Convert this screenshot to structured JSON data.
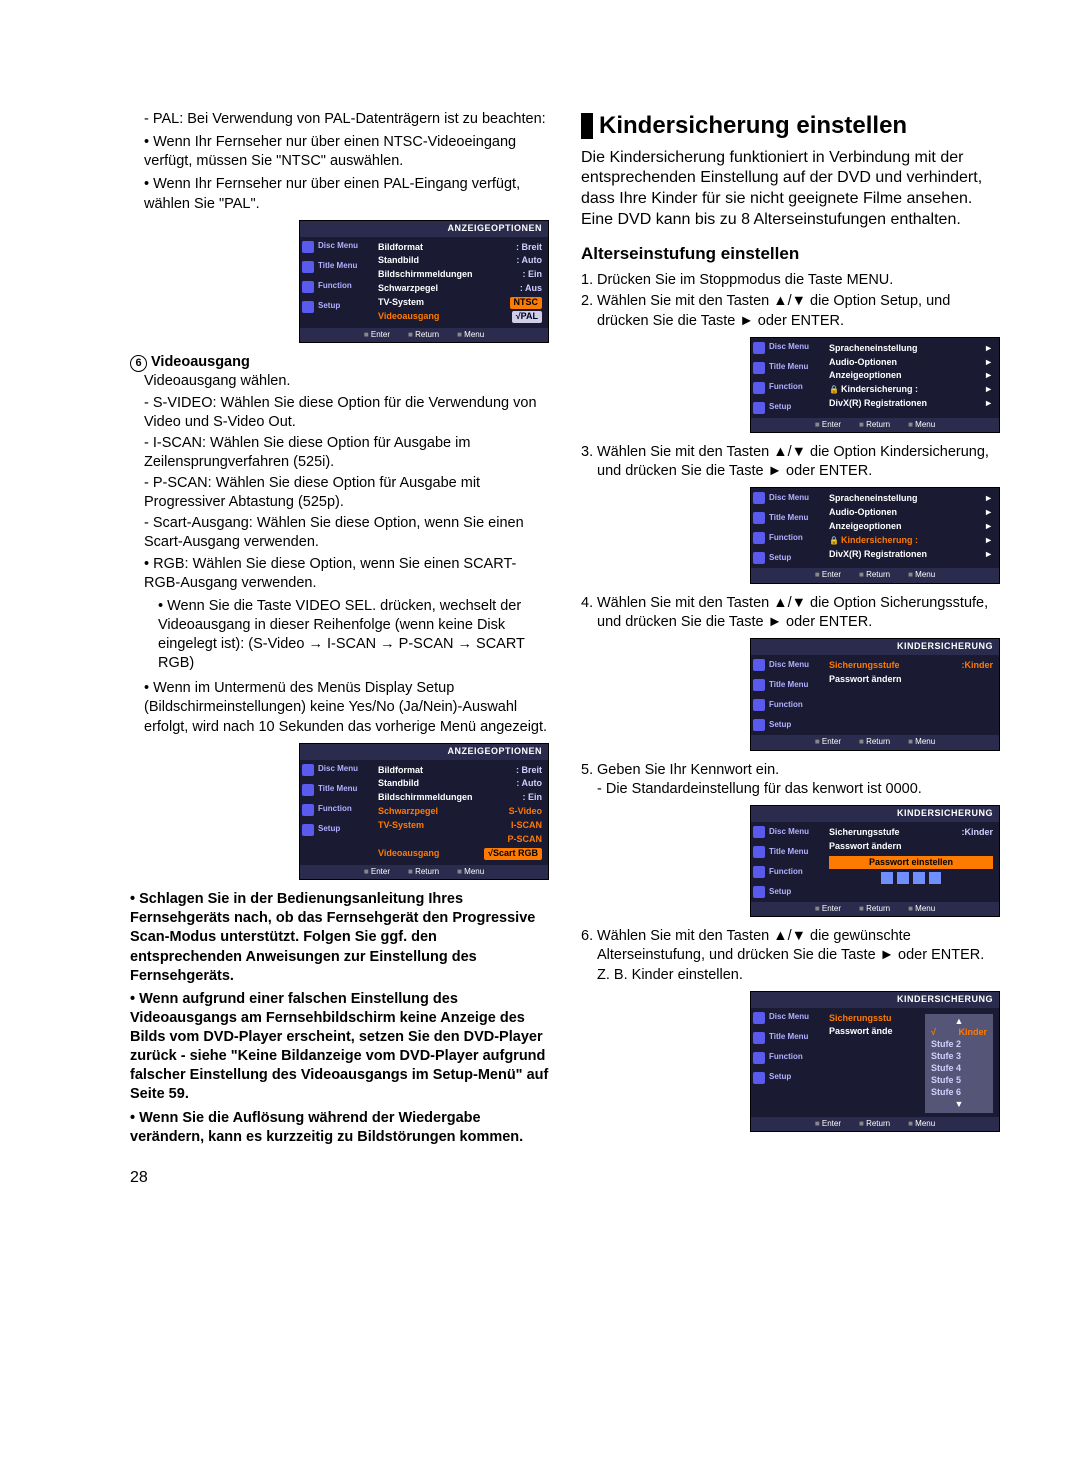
{
  "page_number": "28",
  "left": {
    "pal_note": "- PAL: Bei Verwendung von PAL-Datenträgern ist zu beachten:",
    "ntsc_bullet": "• Wenn Ihr Fernseher nur über einen NTSC-Videoeingang verfügt, müssen Sie \"NTSC\" auswählen.",
    "pal_bullet": "• Wenn Ihr Fernseher nur über einen PAL-Eingang verfügt, wählen Sie \"PAL\".",
    "osd1": {
      "title": "ANZEIGEOPTIONEN",
      "sidebar": [
        "Disc Menu",
        "Title Menu",
        "Function",
        "Setup"
      ],
      "rows": [
        {
          "l": "Bildformat",
          "v": ": Breit"
        },
        {
          "l": "Standbild",
          "v": ": Auto"
        },
        {
          "l": "Bildschirmmeldungen",
          "v": ": Ein"
        },
        {
          "l": "Schwarzpegel",
          "v": ": Aus"
        },
        {
          "l": "TV-System",
          "v": "NTSC",
          "style": "badge"
        },
        {
          "l": "Videoausgang",
          "v": "√PAL",
          "style": "drop"
        }
      ],
      "footer": [
        "Enter",
        "Return",
        "Menu"
      ]
    },
    "videoausgang_h": "Videoausgang",
    "videoausgang_p": "Videoausgang wählen.",
    "svideo": "- S-VIDEO: Wählen Sie diese Option für die Verwendung von Video und S-Video Out.",
    "iscan": "- I-SCAN: Wählen Sie diese Option für Ausgabe im Zeilensprungverfahren (525i).",
    "pscan": "- P-SCAN: Wählen Sie diese Option für Ausgabe mit Progressiver Abtastung (525p).",
    "scart": "- Scart-Ausgang: Wählen Sie diese Option, wenn Sie einen Scart-Ausgang verwenden.",
    "rgb": "• RGB: Wählen Sie diese Option, wenn Sie einen SCART-RGB-Ausgang verwenden.",
    "videosel": "• Wenn Sie die Taste VIDEO SEL. drücken, wechselt der Videoausgang in dieser Reihenfolge (wenn keine Disk eingelegt ist): (S-Video → I-SCAN → P-SCAN → SCART RGB)",
    "submenu_note": "• Wenn im Untermenü des Menüs Display Setup (Bildschirmeinstellungen) keine Yes/No (Ja/Nein)-Auswahl erfolgt, wird nach 10 Sekunden das vorherige Menü angezeigt.",
    "osd2": {
      "title": "ANZEIGEOPTIONEN",
      "rows": [
        {
          "l": "Bildformat",
          "v": ": Breit"
        },
        {
          "l": "Standbild",
          "v": ": Auto"
        },
        {
          "l": "Bildschirmmeldungen",
          "v": ": Ein"
        },
        {
          "l": "Schwarzpegel",
          "v": "S-Video",
          "style": "hl"
        },
        {
          "l": "TV-System",
          "v": "I-SCAN",
          "style": "hl"
        },
        {
          "l": "",
          "v": "P-SCAN",
          "style": "hl"
        },
        {
          "l": "Videoausgang",
          "v": "√Scart RGB",
          "style": "hlbadge"
        }
      ]
    },
    "warn1": "• Schlagen Sie in der Bedienungsanleitung Ihres Fernsehgeräts nach, ob das Fernsehgerät den Progressive Scan-Modus unterstützt. Folgen Sie ggf. den entsprechenden Anweisungen zur Einstellung des Fernsehgeräts.",
    "warn2": "• Wenn aufgrund einer falschen Einstellung des Videoausgangs am Fernsehbildschirm keine Anzeige des Bilds vom DVD-Player erscheint, setzen Sie den DVD-Player zurück - siehe \"Keine Bildanzeige vom DVD-Player aufgrund falscher Einstellung des Videoausgangs im Setup-Menü\" auf Seite 59.",
    "warn3": "• Wenn Sie die Auflösung während der Wiedergabe verändern, kann es kurzzeitig zu Bildstörungen kommen."
  },
  "right": {
    "title": "Kindersicherung einstellen",
    "intro": "Die Kindersicherung funktioniert in Verbindung mit der entsprechenden Einstellung auf der DVD und verhindert, dass Ihre Kinder für sie nicht geeignete Filme ansehen. Eine DVD kann bis zu 8 Alterseinstufungen enthalten.",
    "sub": "Alterseinstufung einstellen",
    "s1": "Drücken Sie im Stoppmodus die Taste MENU.",
    "s2a": "Wählen Sie mit den Tasten ",
    "s2b": " die Option Setup, und drücken Sie die Taste ► oder ENTER.",
    "osd_setup": {
      "title": "",
      "rows": [
        {
          "l": "Spracheneinstellung",
          "v": "►"
        },
        {
          "l": "Audio-Optionen",
          "v": "►"
        },
        {
          "l": "Anzeigeoptionen",
          "v": "►"
        },
        {
          "l": "Kindersicherung :",
          "v": "►",
          "lock": true
        },
        {
          "l": "DivX(R) Registrationen",
          "v": "►"
        }
      ]
    },
    "s3a": "Wählen Sie mit den Tasten ",
    "s3b": " die Option Kindersicherung, und drücken Sie die Taste ► oder ENTER.",
    "s4a": "Wählen Sie mit den Tasten ",
    "s4b": " die Option Sicherungsstufe, und drücken Sie die Taste ► oder ENTER.",
    "osd_kind1": {
      "title": "KINDERSICHERUNG",
      "rows": [
        {
          "l": "Sicherungsstufe",
          "v": ":Kinder",
          "hl": true
        },
        {
          "l": "Passwort ändern",
          "v": ""
        }
      ]
    },
    "s5": "Geben Sie Ihr Kennwort ein.",
    "s5b": "- Die Standardeinstellung für das kenwort ist 0000.",
    "osd_kind2": {
      "title": "KINDERSICHERUNG",
      "rows": [
        {
          "l": "Sicherungsstufe",
          "v": ":Kinder"
        },
        {
          "l": "Passwort ändern",
          "v": ""
        }
      ],
      "pwlabel": "Passwort einstellen"
    },
    "s6a": "Wählen Sie mit den Tasten ",
    "s6b": " die gewünschte Alterseinstufung, und drücken Sie die Taste ► oder ENTER. Z. B. Kinder einstellen.",
    "osd_kind3": {
      "title": "KINDERSICHERUNG",
      "rows": [
        {
          "l": "Sicherungsstu",
          "v": ""
        },
        {
          "l": "Passwort ände",
          "v": ""
        }
      ],
      "levels": [
        "Kinder",
        "Stufe 2",
        "Stufe 3",
        "Stufe 4",
        "Stufe 5",
        "Stufe 6"
      ]
    },
    "updown": "▲/▼",
    "footer": [
      "Enter",
      "Return",
      "Menu"
    ],
    "sidebar": [
      "Disc Menu",
      "Title Menu",
      "Function",
      "Setup"
    ]
  }
}
